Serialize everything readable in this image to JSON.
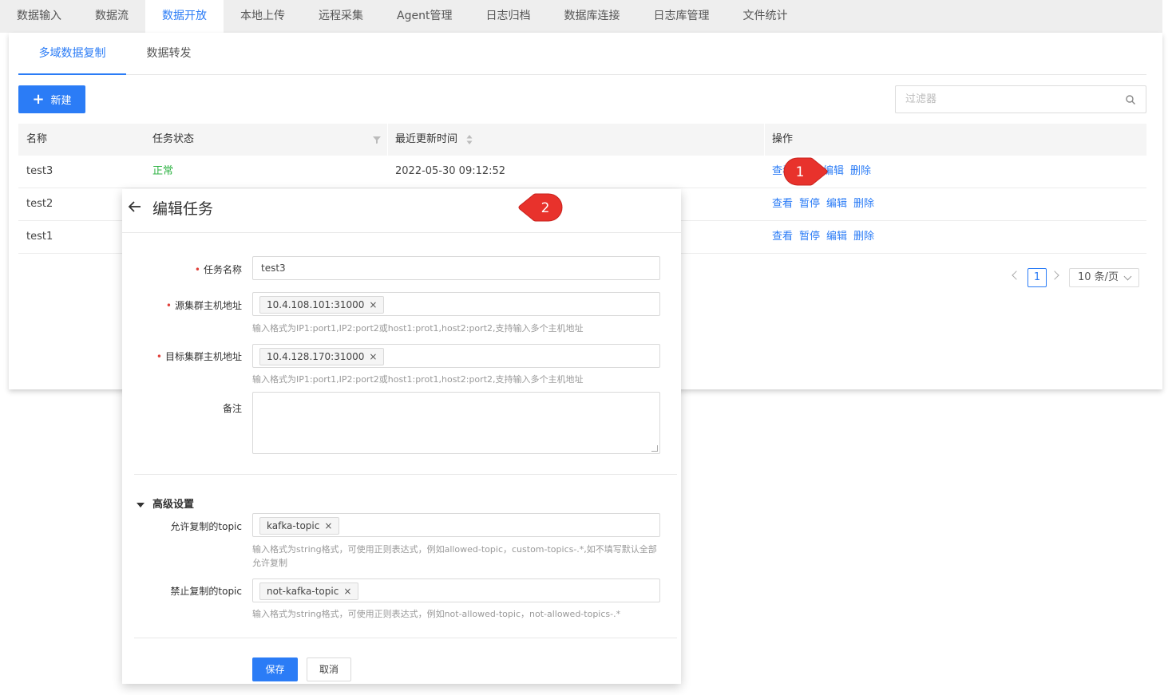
{
  "topnav": {
    "tabs": [
      "数据输入",
      "数据流",
      "数据开放",
      "本地上传",
      "远程采集",
      "Agent管理",
      "日志归档",
      "数据库连接",
      "日志库管理",
      "文件统计"
    ],
    "active_index": 2
  },
  "subtabs": [
    "多域数据复制",
    "数据转发"
  ],
  "toolbar": {
    "new_label": "新建",
    "filter_placeholder": "过滤器"
  },
  "table": {
    "headers": [
      "名称",
      "任务状态",
      "最近更新时间",
      "操作"
    ],
    "rows": [
      {
        "name": "test3",
        "status": "正常",
        "time": "2022-05-30 09:12:52",
        "actions": [
          "查看",
          "编辑",
          "删除"
        ]
      },
      {
        "name": "test2",
        "status": "",
        "time": "",
        "actions": [
          "查看",
          "暂停",
          "编辑",
          "删除"
        ]
      },
      {
        "name": "test1",
        "status": "",
        "time": "",
        "actions": [
          "查看",
          "暂停",
          "编辑",
          "删除"
        ]
      }
    ]
  },
  "pagination": {
    "current_page": "1",
    "page_size": "10 条/页"
  },
  "modal": {
    "title": "编辑任务",
    "fields": {
      "task_name": {
        "label": "任务名称",
        "value": "test3"
      },
      "source": {
        "label": "源集群主机地址",
        "tag": "10.4.108.101:31000",
        "hint": "输入格式为IP1:port1,IP2:port2或host1:prot1,host2:port2,支持输入多个主机地址"
      },
      "target": {
        "label": "目标集群主机地址",
        "tag": "10.4.128.170:31000",
        "hint": "输入格式为IP1:port1,IP2:port2或host1:prot1,host2:port2,支持输入多个主机地址"
      },
      "remark": {
        "label": "备注"
      }
    },
    "advanced": {
      "title": "高级设置",
      "allow": {
        "label": "允许复制的topic",
        "tag": "kafka-topic",
        "hint": "输入格式为string格式，可使用正则表达式，例如allowed-topic，custom-topics-.*,如不填写默认全部允许复制"
      },
      "deny": {
        "label": "禁止复制的topic",
        "tag": "not-kafka-topic",
        "hint": "输入格式为string格式，可使用正则表达式，例如not-allowed-topic，not-allowed-topics-.*"
      }
    },
    "save_label": "保存",
    "cancel_label": "取消"
  },
  "callouts": [
    "1",
    "2"
  ],
  "colors": {
    "accent": "#2b7cf6",
    "success": "#2fb344",
    "required": "#e0403a",
    "callout": "#e8322c"
  }
}
